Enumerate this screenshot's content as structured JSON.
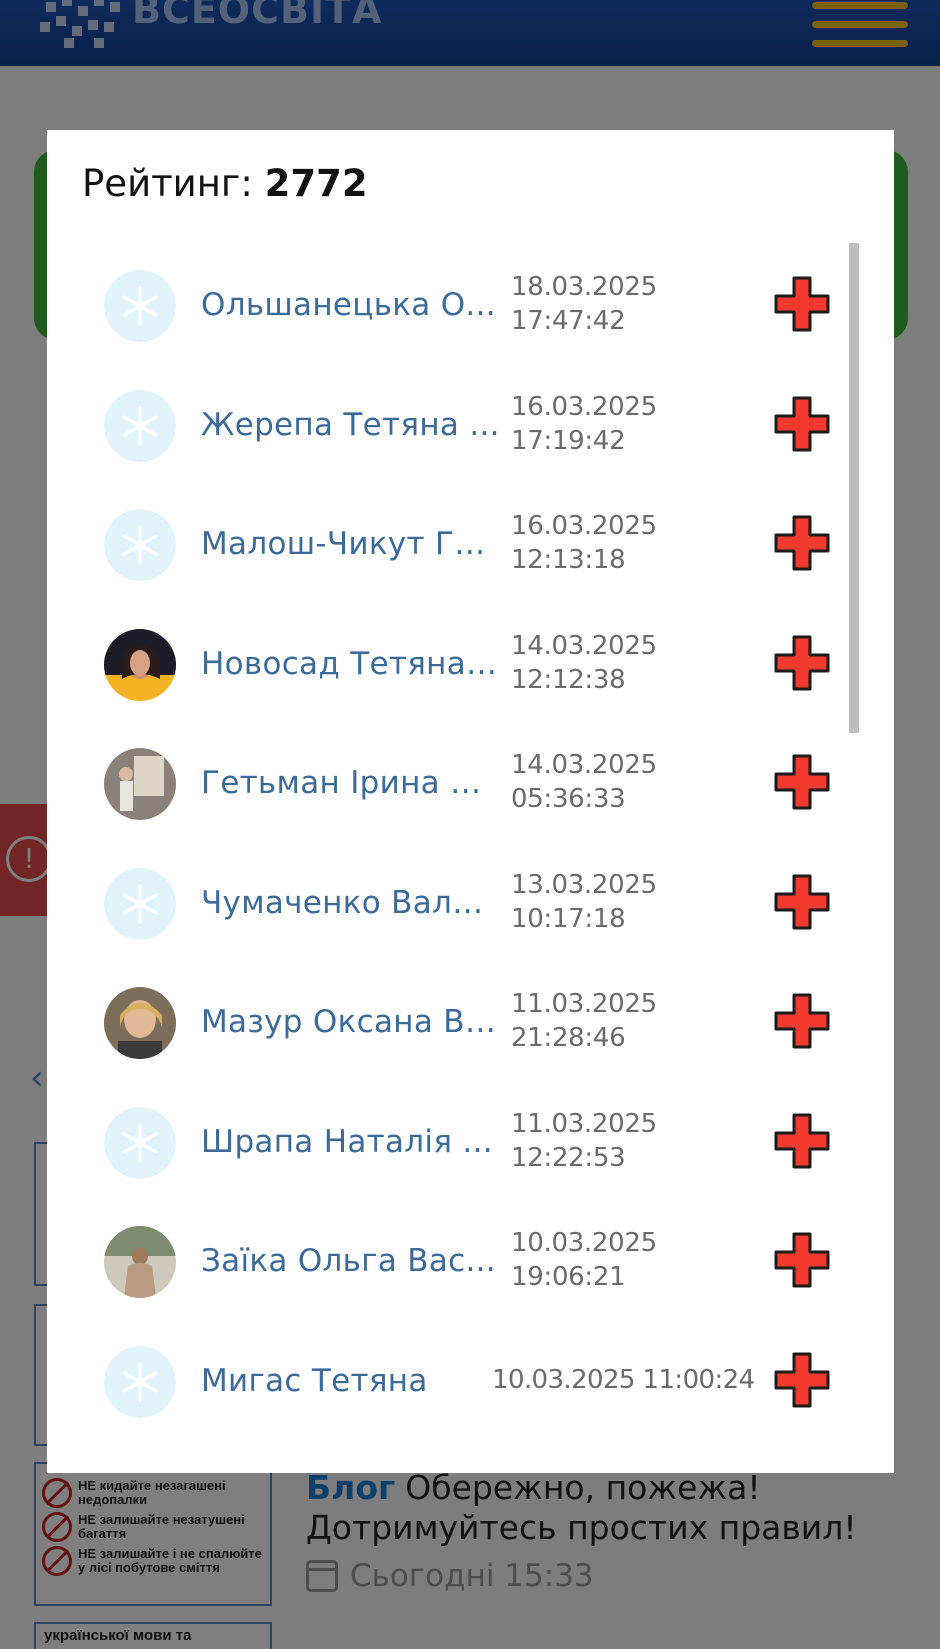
{
  "background": {
    "brand": "ВСЕОСВІТА",
    "blog_tag": "Блог",
    "blog_title": "Обережно, пожежа! Дотримуйтесь простих правил!",
    "blog_date": "Сьогодні 15:33",
    "rules": [
      "НЕ кидайте незагашені недопалки",
      "НЕ залишайте незатушені багаття",
      "НЕ залишайте і не спалюйте у лісі побутове сміття"
    ],
    "thumb_text": "української мови та"
  },
  "modal": {
    "title_label": "Рейтинг:",
    "title_value": "2772",
    "items": [
      {
        "name": "Ольшанецька О...",
        "date": "18.03.2025",
        "time": "17:47:42",
        "avatar": "default"
      },
      {
        "name": "Жерепа Тетяна ...",
        "date": "16.03.2025",
        "time": "17:19:42",
        "avatar": "default"
      },
      {
        "name": "Малош-Чикут Га...",
        "date": "16.03.2025",
        "time": "12:13:18",
        "avatar": "default"
      },
      {
        "name": "Новосад Тетяна ...",
        "date": "14.03.2025",
        "time": "12:12:38",
        "avatar": "photo"
      },
      {
        "name": "Гетьман Ірина Д...",
        "date": "14.03.2025",
        "time": "05:36:33",
        "avatar": "photo"
      },
      {
        "name": "Чумаченко Вале...",
        "date": "13.03.2025",
        "time": "10:17:18",
        "avatar": "default"
      },
      {
        "name": "Мазур Оксана Ві...",
        "date": "11.03.2025",
        "time": "21:28:46",
        "avatar": "photo"
      },
      {
        "name": "Шрапа Наталія ...",
        "date": "11.03.2025",
        "time": "12:22:53",
        "avatar": "default"
      },
      {
        "name": "Заїка Ольга Вас...",
        "date": "10.03.2025",
        "time": "19:06:21",
        "avatar": "photo"
      },
      {
        "name": "Мигас Тетяна",
        "date": "10.03.2025 11:00:24",
        "time": "",
        "avatar": "default"
      }
    ]
  },
  "colors": {
    "header": "#1a4aa3",
    "name_text": "#3d6b99",
    "plus_icon": "#f23b2e",
    "default_avatar": "#e1f4fb"
  }
}
